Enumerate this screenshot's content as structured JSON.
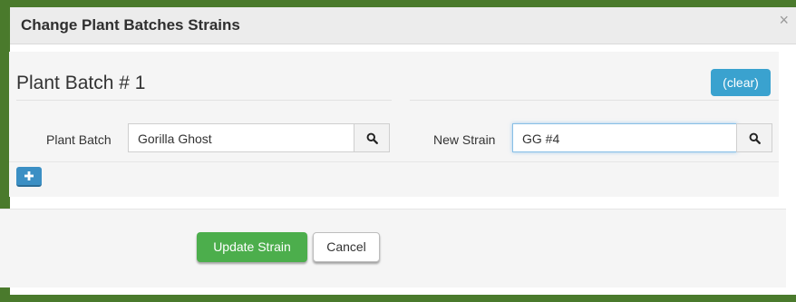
{
  "modal": {
    "title": "Change Plant Batches Strains",
    "close_glyph": "×"
  },
  "batch": {
    "heading": "Plant Batch # 1",
    "clear_label": "(clear)",
    "plant_batch_label": "Plant Batch",
    "plant_batch_value": "Gorilla Ghost",
    "new_strain_label": "New Strain",
    "new_strain_value": "GG #4",
    "add_label": "+"
  },
  "footer": {
    "update_label": "Update Strain",
    "cancel_label": "Cancel"
  },
  "colors": {
    "frame_green": "#4a7a2c",
    "clear_blue": "#3aa2cf",
    "update_green": "#4cae4c",
    "add_blue": "#3b8fc4"
  },
  "icons": {
    "search": "search-icon",
    "plus": "plus-icon",
    "close": "close-icon"
  }
}
